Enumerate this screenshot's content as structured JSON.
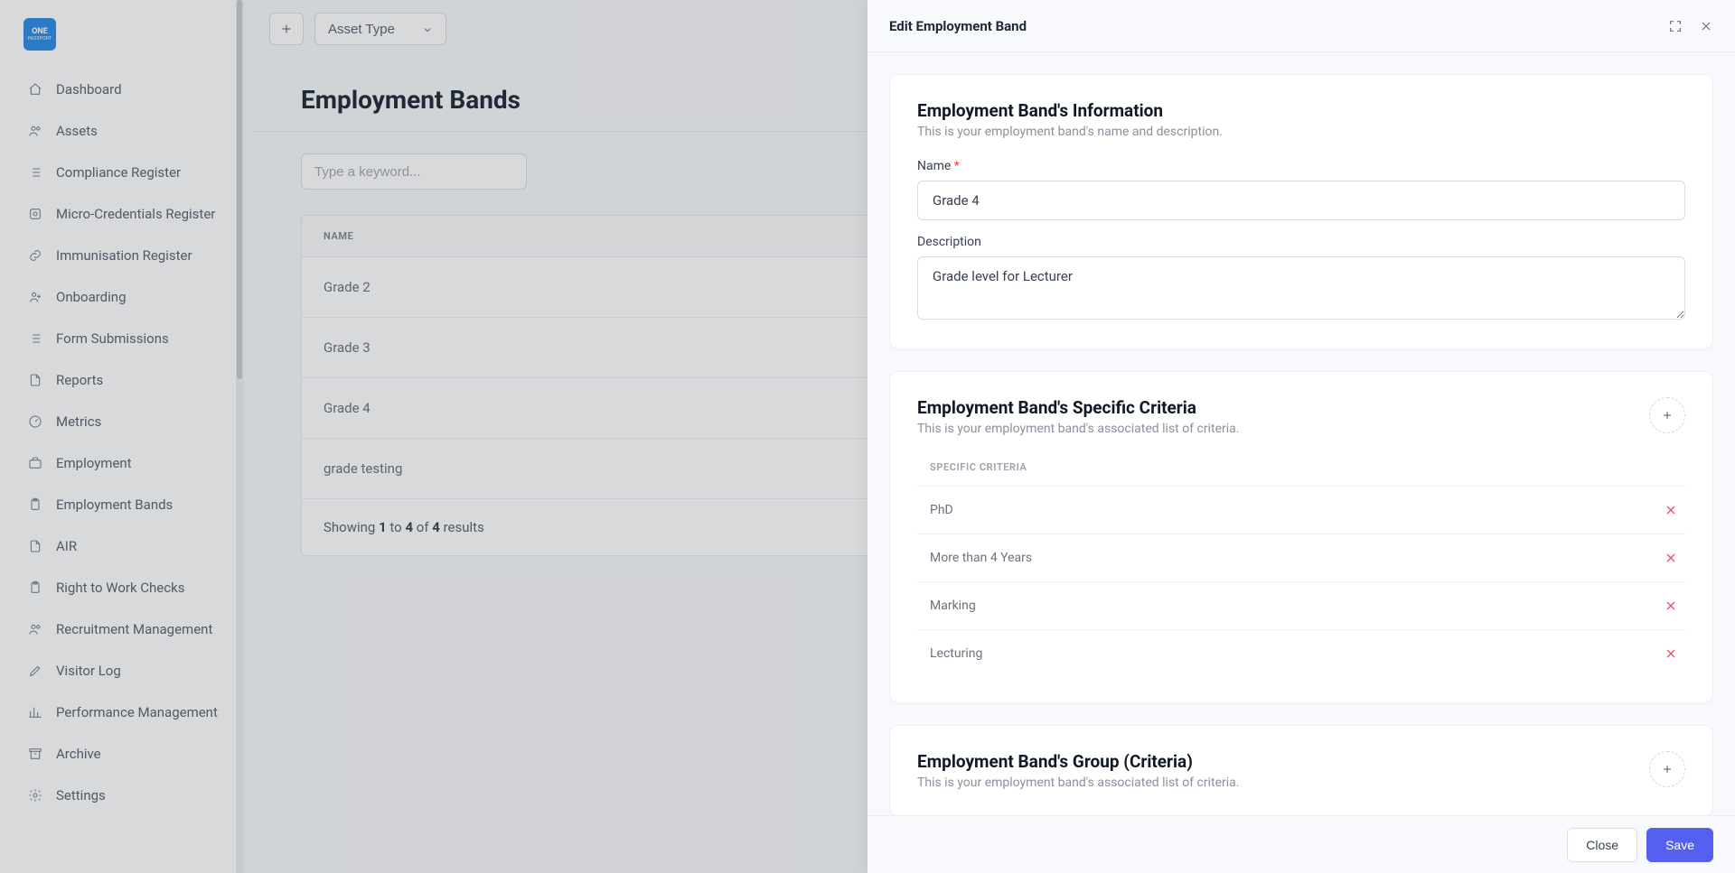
{
  "logo": {
    "line1": "ONE",
    "line2": "PASSPORT"
  },
  "sidebar": {
    "items": [
      {
        "label": "Dashboard",
        "icon": "home-icon"
      },
      {
        "label": "Assets",
        "icon": "users-icon"
      },
      {
        "label": "Compliance Register",
        "icon": "list-icon"
      },
      {
        "label": "Micro-Credentials Register",
        "icon": "badge-icon"
      },
      {
        "label": "Immunisation Register",
        "icon": "link-icon"
      },
      {
        "label": "Onboarding",
        "icon": "person-plus-icon"
      },
      {
        "label": "Form Submissions",
        "icon": "list-icon"
      },
      {
        "label": "Reports",
        "icon": "file-icon"
      },
      {
        "label": "Metrics",
        "icon": "gauge-icon"
      },
      {
        "label": "Employment",
        "icon": "briefcase-icon"
      },
      {
        "label": "Employment Bands",
        "icon": "clipboard-icon"
      },
      {
        "label": "AIR",
        "icon": "file-icon"
      },
      {
        "label": "Right to Work Checks",
        "icon": "clipboard-icon"
      },
      {
        "label": "Recruitment Management",
        "icon": "users-icon"
      },
      {
        "label": "Visitor Log",
        "icon": "pen-icon"
      },
      {
        "label": "Performance Management",
        "icon": "chart-icon"
      },
      {
        "label": "Archive",
        "icon": "archive-icon"
      },
      {
        "label": "Settings",
        "icon": "gear-icon"
      }
    ]
  },
  "topbar": {
    "asset_type_label": "Asset Type"
  },
  "page": {
    "title": "Employment Bands",
    "search_placeholder": "Type a keyword...",
    "table": {
      "header_name": "NAME",
      "rows": [
        {
          "name": "Grade 2"
        },
        {
          "name": "Grade 3"
        },
        {
          "name": "Grade 4"
        },
        {
          "name": "grade testing"
        }
      ],
      "footer_prefix": "Showing ",
      "footer_a": "1",
      "footer_to": " to ",
      "footer_b": "4",
      "footer_of": " of ",
      "footer_c": "4",
      "footer_suffix": " results"
    }
  },
  "drawer": {
    "title": "Edit Employment Band",
    "info": {
      "heading": "Employment Band's Information",
      "sub": "This is your employment band's name and description.",
      "name_label": "Name",
      "name_value": "Grade 4",
      "desc_label": "Description",
      "desc_value": "Grade level for Lecturer"
    },
    "criteria": {
      "heading": "Employment Band's Specific Criteria",
      "sub": "This is your employment band's associated list of criteria.",
      "list_header": "SPECIFIC CRITERIA",
      "items": [
        {
          "label": "PhD"
        },
        {
          "label": "More than 4 Years"
        },
        {
          "label": "Marking"
        },
        {
          "label": "Lecturing"
        }
      ]
    },
    "group": {
      "heading": "Employment Band's Group (Criteria)",
      "sub": "This is your employment band's associated list of criteria."
    },
    "footer": {
      "close": "Close",
      "save": "Save"
    }
  }
}
